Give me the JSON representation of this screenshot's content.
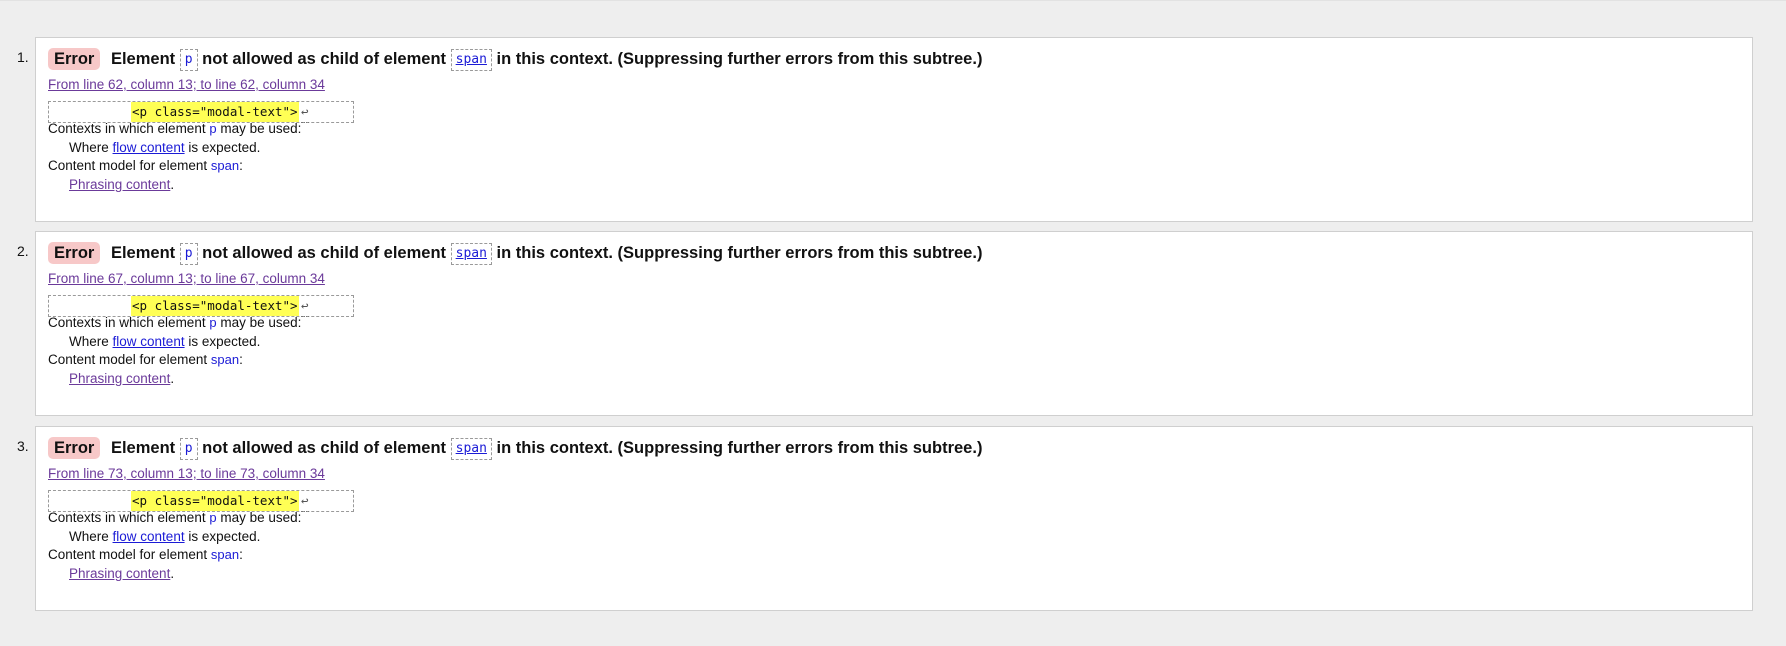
{
  "errors": [
    {
      "number": "1.",
      "badge": "Error",
      "msg_prefix": "Element",
      "child": "p",
      "msg_mid": "not allowed as child of element",
      "parent": "span",
      "msg_suffix": "in this context. (Suppressing further errors from this subtree.)",
      "location": "From line 62, column 13; to line 62, column 34",
      "extract": "<p class=\"modal-text\">",
      "extract_lf": "↩",
      "contexts_label_prefix": "Contexts in which element",
      "contexts_label_elem": "p",
      "contexts_label_suffix": "may be used:",
      "where_prefix": "Where",
      "where_link": "flow content",
      "where_suffix": "is expected.",
      "model_label_prefix": "Content model for element",
      "model_label_elem": "span",
      "model_label_suffix": ":",
      "model_link": "Phrasing content",
      "model_suffix": "."
    },
    {
      "number": "2.",
      "badge": "Error",
      "msg_prefix": "Element",
      "child": "p",
      "msg_mid": "not allowed as child of element",
      "parent": "span",
      "msg_suffix": "in this context. (Suppressing further errors from this subtree.)",
      "location": "From line 67, column 13; to line 67, column 34",
      "extract": "<p class=\"modal-text\">",
      "extract_lf": "↩",
      "contexts_label_prefix": "Contexts in which element",
      "contexts_label_elem": "p",
      "contexts_label_suffix": "may be used:",
      "where_prefix": "Where",
      "where_link": "flow content",
      "where_suffix": "is expected.",
      "model_label_prefix": "Content model for element",
      "model_label_elem": "span",
      "model_label_suffix": ":",
      "model_link": "Phrasing content",
      "model_suffix": "."
    },
    {
      "number": "3.",
      "badge": "Error",
      "msg_prefix": "Element",
      "child": "p",
      "msg_mid": "not allowed as child of element",
      "parent": "span",
      "msg_suffix": "in this context. (Suppressing further errors from this subtree.)",
      "location": "From line 73, column 13; to line 73, column 34",
      "extract": "<p class=\"modal-text\">",
      "extract_lf": "↩",
      "contexts_label_prefix": "Contexts in which element",
      "contexts_label_elem": "p",
      "contexts_label_suffix": "may be used:",
      "where_prefix": "Where",
      "where_link": "flow content",
      "where_suffix": "is expected.",
      "model_label_prefix": "Content model for element",
      "model_label_elem": "span",
      "model_label_suffix": ":",
      "model_link": "Phrasing content",
      "model_suffix": "."
    }
  ],
  "colors": {
    "error_badge_bg": "#f7c8c8",
    "highlight": "#ffff55",
    "link": "#1b1bd6",
    "visited_link": "#6b3a9a",
    "panel_bg": "#eeeeee"
  }
}
